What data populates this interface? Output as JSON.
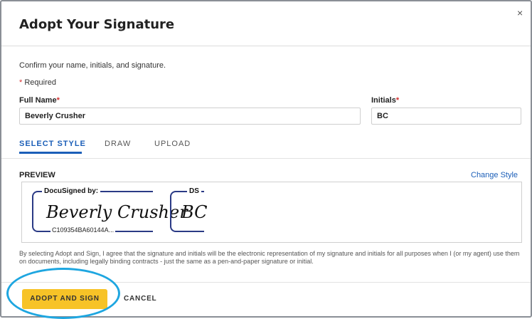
{
  "dialog": {
    "title": "Adopt Your Signature",
    "close_icon": "close-icon",
    "close_glyph": "×",
    "instruction": "Confirm your name, initials, and signature.",
    "required_star": "*",
    "required_label": "Required"
  },
  "form": {
    "full_name_label": "Full Name",
    "full_name_value": "Beverly Crusher",
    "initials_label": "Initials",
    "initials_value": "BC",
    "required_marker": "*"
  },
  "tabs": [
    {
      "label": "SELECT STYLE",
      "active": true
    },
    {
      "label": "DRAW",
      "active": false
    },
    {
      "label": "UPLOAD",
      "active": false
    }
  ],
  "preview": {
    "label": "PREVIEW",
    "change_style": "Change Style",
    "signature_header": "DocuSigned by:",
    "signature_text": "Beverly Crusher",
    "signature_id": "C109354BA60144A...",
    "initials_header": "DS",
    "initials_text": "BC"
  },
  "disclaimer": "By selecting Adopt and Sign, I agree that the signature and initials will be the electronic representation of my signature and initials for all purposes when I (or my agent) use them on documents, including legally binding contracts - just the same as a pen-and-paper signature or initial.",
  "footer": {
    "adopt_button": "ADOPT AND SIGN",
    "cancel_button": "CANCEL"
  },
  "colors": {
    "accent": "#1c5fb8",
    "button": "#f7c327",
    "highlight_ring": "#1ea6e0",
    "signature_bracket": "#2a3a85"
  }
}
